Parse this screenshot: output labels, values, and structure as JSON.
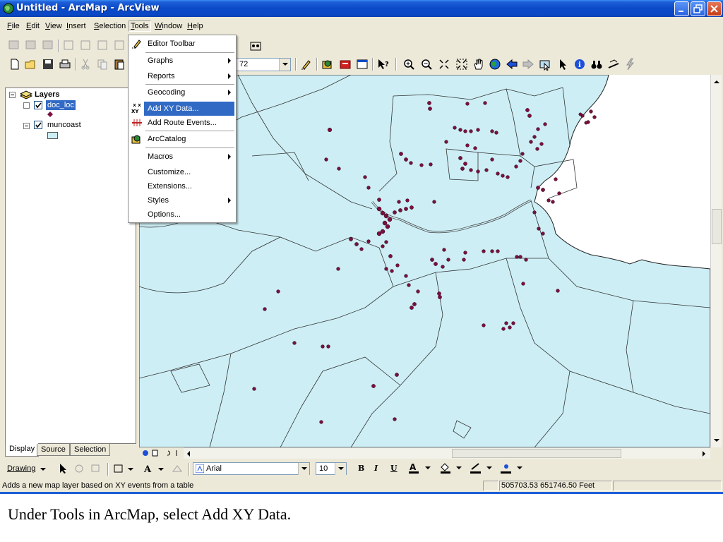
{
  "window": {
    "title": "Untitled - ArcMap - ArcView",
    "app_icon": "globe-icon"
  },
  "menubar": [
    {
      "label": "File",
      "key": "F",
      "rest": "ile"
    },
    {
      "label": "Edit",
      "key": "E",
      "rest": "dit"
    },
    {
      "label": "View",
      "key": "V",
      "rest": "iew"
    },
    {
      "label": "Insert",
      "key": "I",
      "rest": "nsert"
    },
    {
      "label": "Selection",
      "key": "S",
      "rest": "election"
    },
    {
      "label": "Tools",
      "key": "T",
      "rest": "ools"
    },
    {
      "label": "Window",
      "key": "W",
      "rest": "indow"
    },
    {
      "label": "Help",
      "key": "H",
      "rest": "elp"
    }
  ],
  "toolbar": {
    "scale_value": "72"
  },
  "tools_menu": {
    "items": [
      {
        "label": "Editor Toolbar",
        "icon": "editor-pencil-icon",
        "submenu": false
      },
      {
        "label": "Graphs",
        "submenu": true
      },
      {
        "label": "Reports",
        "submenu": true
      },
      {
        "label": "Geocoding",
        "submenu": true
      },
      {
        "label": "Add XY Data...",
        "icon": "xy-data-icon",
        "submenu": false,
        "highlighted": true
      },
      {
        "label": "Add Route Events...",
        "icon": "route-events-icon",
        "submenu": false
      },
      {
        "label": "ArcCatalog",
        "icon": "arccatalog-icon",
        "submenu": false
      },
      {
        "label": "Macros",
        "submenu": true
      },
      {
        "label": "Customize...",
        "submenu": false
      },
      {
        "label": "Extensions...",
        "submenu": false
      },
      {
        "label": "Styles",
        "submenu": true
      },
      {
        "label": "Options...",
        "submenu": false
      }
    ]
  },
  "toc": {
    "root": "Layers",
    "layers": [
      {
        "name": "doc_loc",
        "checked": true,
        "selected": true
      },
      {
        "name": "muncoast",
        "checked": true,
        "selected": false
      }
    ],
    "tabs": [
      "Display",
      "Source",
      "Selection"
    ],
    "active_tab": "Display"
  },
  "map": {
    "land_color": "#cdeef5",
    "point_color": "#7a1040"
  },
  "drawing_toolbar": {
    "drawing_label": "Drawing",
    "font": "Arial",
    "font_size": "10",
    "bold": "B",
    "italic": "I",
    "underline": "U"
  },
  "statusbar": {
    "message": "Adds a new map layer based on XY events from a table",
    "coordinates": "505703.53  651746.50 Feet"
  },
  "caption": "Under Tools in ArcMap, select Add XY Data."
}
